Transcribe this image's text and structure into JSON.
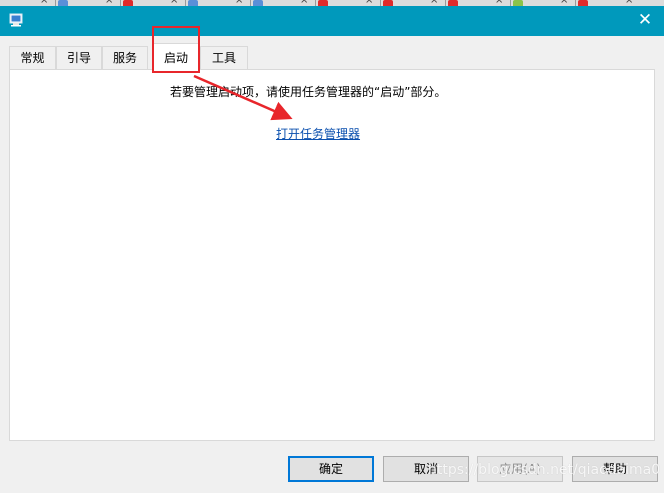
{
  "tabs": [
    {
      "label": "常规"
    },
    {
      "label": "引导"
    },
    {
      "label": "服务"
    },
    {
      "label": "启动",
      "active": true
    },
    {
      "label": "工具"
    }
  ],
  "startup": {
    "message": "若要管理启动项，请使用任务管理器的“启动”部分。",
    "link": "打开任务管理器"
  },
  "buttons": {
    "ok": "确定",
    "cancel": "取消",
    "apply": "应用(A)",
    "help": "帮助"
  },
  "watermark": "https://blog.csdn.net/qiaodaima0",
  "colors": {
    "titlebar": "#0099bc",
    "annotation": "#e8262b",
    "link": "#0a4fae"
  }
}
